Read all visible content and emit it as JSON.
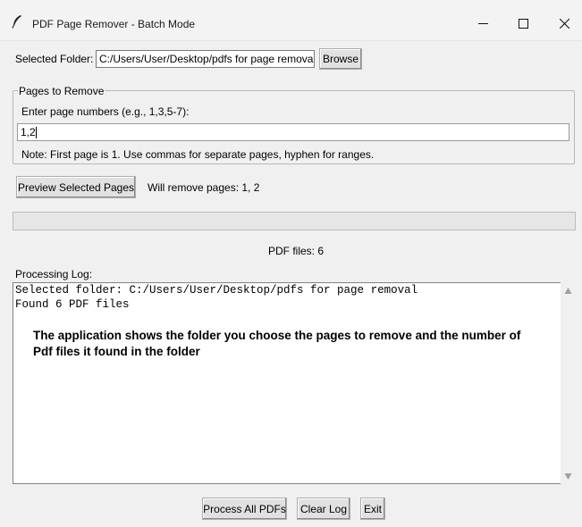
{
  "window": {
    "title": "PDF Page Remover - Batch Mode"
  },
  "folder": {
    "label": "Selected Folder:",
    "path": "C:/Users/User/Desktop/pdfs for page removal",
    "browse_label": "Browse"
  },
  "pages": {
    "group_title": "Pages to Remove",
    "prompt": "Enter page numbers (e.g., 1,3,5-7):",
    "value": "1,2",
    "note": "Note: First page is 1. Use commas for separate pages, hyphen for ranges."
  },
  "preview": {
    "button_label": "Preview Selected Pages",
    "status": "Will remove pages: 1, 2"
  },
  "progress": {
    "percent": 0
  },
  "file_count": "PDF files: 6",
  "log": {
    "label": "Processing Log:",
    "lines": [
      "Selected folder: C:/Users/User/Desktop/pdfs for page removal",
      "Found 6 PDF files"
    ],
    "annotation": "The application shows the folder you choose the pages to remove and the number of Pdf files it found in the folder"
  },
  "actions": {
    "process_label": "Process All PDFs",
    "clear_label": "Clear Log",
    "exit_label": "Exit"
  },
  "colors": {
    "progress_fill": "#06b025"
  },
  "icons": {
    "app": "feather-icon",
    "minimize": "minimize-icon",
    "maximize": "maximize-icon",
    "close": "close-icon",
    "scroll_up": "triangle-up-icon",
    "scroll_down": "triangle-down-icon"
  }
}
